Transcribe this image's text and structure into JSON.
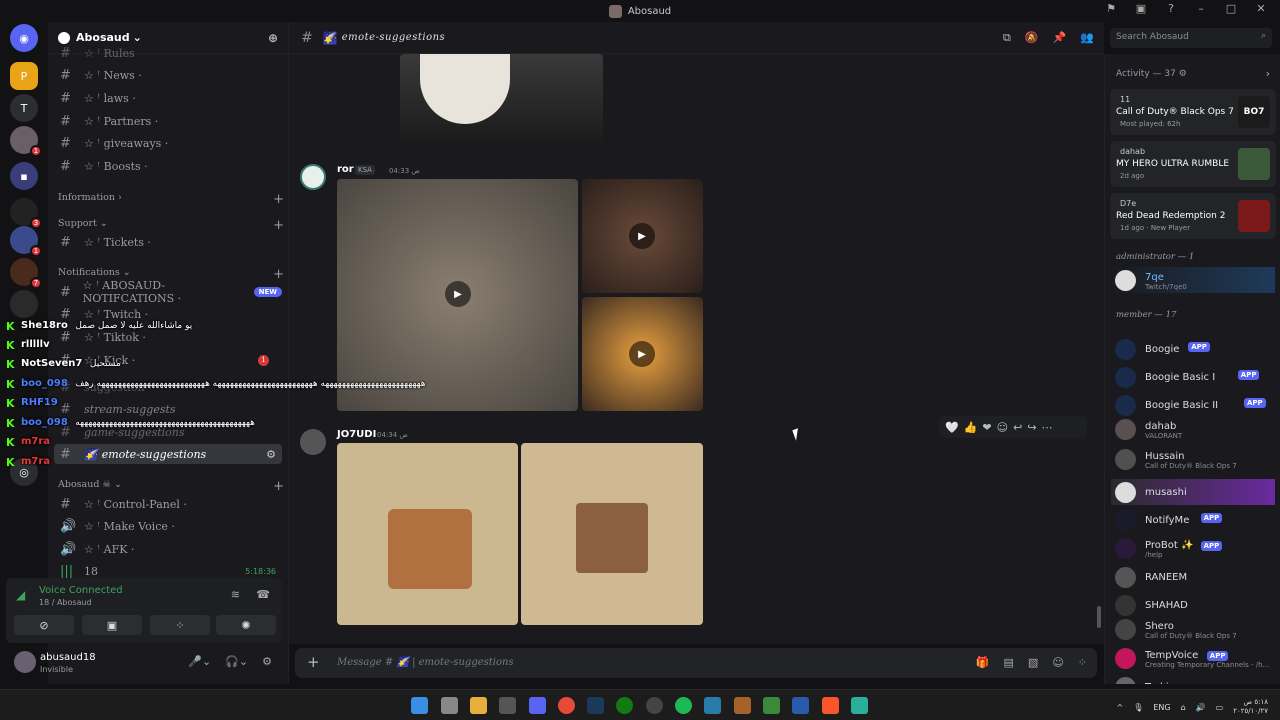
{
  "window": {
    "title": "Abosaud"
  },
  "server": {
    "name": "Abosaud"
  },
  "channels_top": [
    {
      "label": "☆ ꜝ Rules"
    },
    {
      "label": "☆ ꜝ News ·"
    },
    {
      "label": "☆ ꜝ laws ·"
    },
    {
      "label": "☆ ꜝ Partners ·"
    },
    {
      "label": "☆ ꜝ giveaways ·"
    },
    {
      "label": "☆ ꜝ Boosts ·"
    }
  ],
  "categories": {
    "information": "Information ›",
    "support": "Support ⌄",
    "notifications": "Notifications ⌄",
    "abosaud": "Abosaud ☠ ⌄"
  },
  "channels_support": [
    {
      "label": "☆ ꜝ Tickets ·"
    }
  ],
  "channels_notifications": [
    {
      "label": "☆ ꜝ ABOSAUD-NOTIFCATIONS ·",
      "badge": "NEW"
    },
    {
      "label": "☆ ꜝ Twitch ·"
    },
    {
      "label": "☆ ꜝ Tiktok ·"
    },
    {
      "label": "☆ ꜝ Kick ·",
      "count": "1"
    }
  ],
  "channels_suggest": [
    {
      "label": "suggestion"
    },
    {
      "label": "stream-suggests"
    },
    {
      "label": "game-suggestions"
    },
    {
      "label": "emote-suggestions"
    }
  ],
  "channels_abosaud": [
    {
      "label": "☆ ꜝ Control-Panel ·"
    },
    {
      "label": "☆ ꜝ Make Voice ·"
    },
    {
      "label": "☆ ꜝ AFK ·"
    },
    {
      "label": "18",
      "time": "5:18:36"
    }
  ],
  "voice": {
    "status": "Voice Connected",
    "channel": "18 / Abosaud"
  },
  "user": {
    "name": "abusaud18",
    "status": "Invisible"
  },
  "chat": {
    "channel_name": "emote-suggestions",
    "composer_placeholder": "Message # 🌠 | emote-suggestions"
  },
  "search": {
    "placeholder": "Search Abosaud"
  },
  "messages": [
    {
      "user": "ror",
      "tag": "KSA",
      "time": "04:33 ص"
    },
    {
      "user": "JO7UDI",
      "time": "04:34 ص"
    }
  ],
  "members": {
    "activity_header": "Activity — 37 ⚙",
    "activities": [
      {
        "user": "11",
        "game": "Call of Duty® Black Ops 7",
        "meta": "Most played: 62h",
        "art": "BO7",
        "color": "#1b1b1b"
      },
      {
        "user": "dahab",
        "game": "MY HERO ULTRA RUMBLE",
        "meta": "2d ago",
        "art": "",
        "color": "#3a5a3a"
      },
      {
        "user": "D7e",
        "game": "Red Dead Redemption 2",
        "meta": "1d ago  ·  New Player",
        "art": "",
        "color": "#7a1a1a"
      }
    ],
    "admin_header": "administrator — 1",
    "admins": [
      {
        "name": "7qe",
        "sub": "Twitch/7qe0"
      }
    ],
    "member_header": "member — 17",
    "list": [
      {
        "name": "Boogie",
        "app": "APP",
        "sub": "",
        "color": "#1a2a4a"
      },
      {
        "name": "Boogie Basic I",
        "app": "APP",
        "sub": "",
        "color": "#1a2a4a"
      },
      {
        "name": "Boogie Basic II",
        "app": "APP",
        "sub": "",
        "color": "#1a2a4a"
      },
      {
        "name": "dahab",
        "app": "",
        "sub": "VALORANT",
        "color": "#5a5050"
      },
      {
        "name": "Hussain",
        "app": "",
        "sub": "Call of Duty® Black Ops 7",
        "color": "#505050"
      },
      {
        "name": "musashi",
        "app": "",
        "sub": "",
        "color": "#ddd"
      },
      {
        "name": "NotifyMe",
        "app": "APP",
        "sub": "",
        "color": "#1a1a2a"
      },
      {
        "name": "ProBot ✨",
        "app": "APP",
        "sub": "/help",
        "color": "#2a1a3a"
      },
      {
        "name": "RANEEM",
        "app": "",
        "sub": "",
        "color": "#555"
      },
      {
        "name": "SHAHAD",
        "app": "",
        "sub": "",
        "color": "#333"
      },
      {
        "name": "Shero",
        "app": "",
        "sub": "Call of Duty® Black Ops 7",
        "color": "#444"
      },
      {
        "name": "TempVoice",
        "app": "APP",
        "sub": "Creating Temporary Channels - /h...",
        "color": "#c2185b"
      },
      {
        "name": "Turki",
        "app": "",
        "sub": "",
        "color": "#666"
      }
    ]
  },
  "overlay_chat": [
    {
      "user": "She18ro",
      "text": "يو ماشاءالله عليه لا صمل صمل",
      "color": "#ffffff"
    },
    {
      "user": "rlllllv",
      "text": "",
      "color": "#ffffff"
    },
    {
      "user": "NotSeven7",
      "text": "مستحيل",
      "color": "#ffffff"
    },
    {
      "user": "boo_098",
      "text": "ههههههههههههههههههههههههه ههههههههههههههههههههههههه ههههههههههههههههههههههههههه رهف",
      "color": "#4a7fff"
    },
    {
      "user": "RHF19",
      "text": "",
      "color": "#4a7fff"
    },
    {
      "user": "boo_098",
      "text": "ههههههههههههههههههههههههههههههههههههههههههه",
      "color": "#4a7fff"
    },
    {
      "user": "m7ra",
      "text": "",
      "color": "#e53935"
    },
    {
      "user": "m7ra",
      "text": "",
      "color": "#e53935"
    }
  ],
  "tray": {
    "lang": "ENG",
    "time": "٥:١٨ ص",
    "date": "٢٠٢٥/١٠/٢٧"
  }
}
